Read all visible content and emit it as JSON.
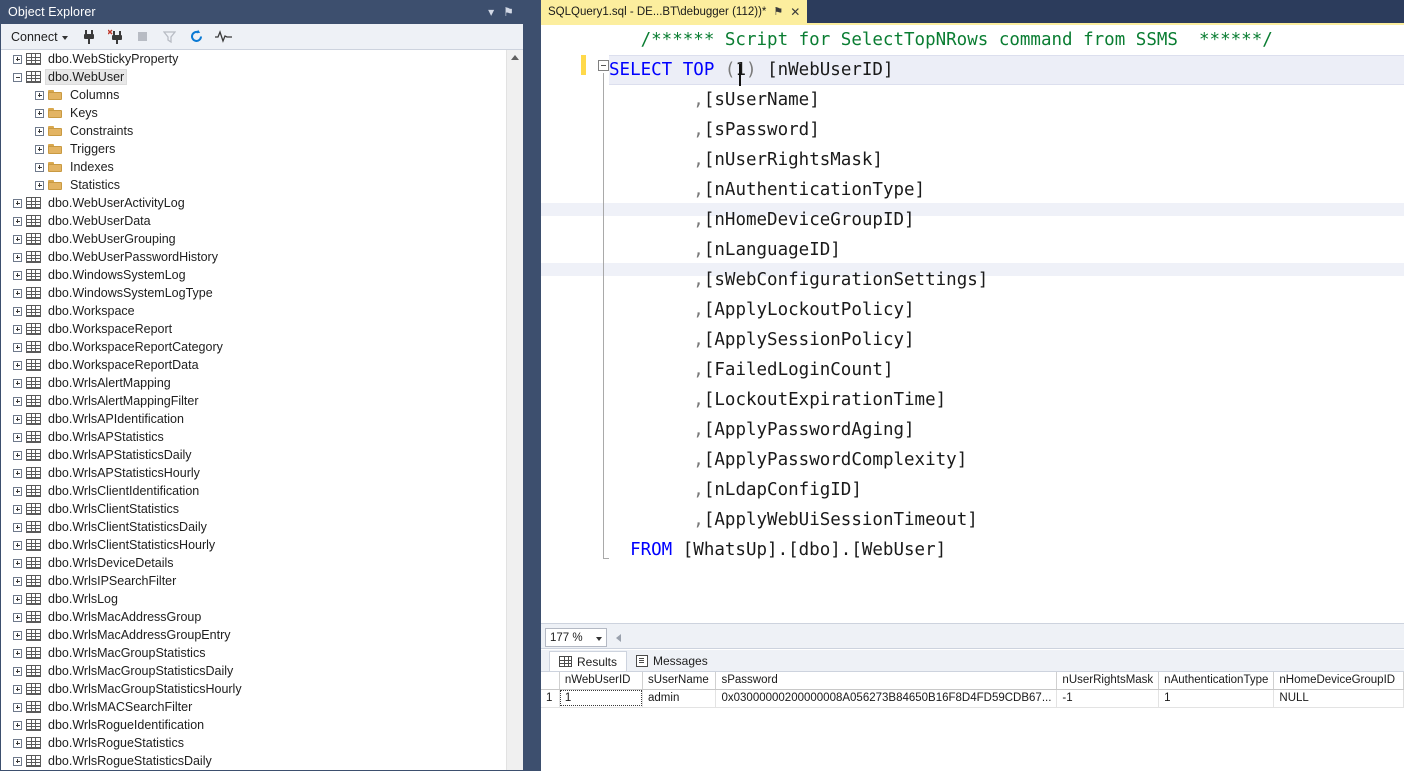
{
  "object_explorer": {
    "title": "Object Explorer",
    "title_buttons": [
      {
        "name": "dropdown-icon",
        "glyph": "▾"
      },
      {
        "name": "pin-icon",
        "glyph": "⚑"
      },
      {
        "name": "close-icon",
        "glyph": "✕"
      }
    ],
    "toolbar": {
      "connect_label": "Connect",
      "icons": [
        {
          "name": "connect-icon",
          "title": "Connect"
        },
        {
          "name": "disconnect-icon",
          "title": "Disconnect"
        },
        {
          "name": "stop-icon",
          "title": "Stop"
        },
        {
          "name": "filter-icon",
          "title": "Filter"
        },
        {
          "name": "refresh-icon",
          "title": "Refresh"
        },
        {
          "name": "activity-monitor-icon",
          "title": "Activity Monitor"
        }
      ]
    },
    "tree": [
      {
        "label": "dbo.WebStickyProperty",
        "indent": 0,
        "icon": "table",
        "state": "plus"
      },
      {
        "label": "dbo.WebUser",
        "indent": 0,
        "icon": "table",
        "state": "minus",
        "selected": true
      },
      {
        "label": "Columns",
        "indent": 1,
        "icon": "folder",
        "state": "plus"
      },
      {
        "label": "Keys",
        "indent": 1,
        "icon": "folder",
        "state": "plus"
      },
      {
        "label": "Constraints",
        "indent": 1,
        "icon": "folder",
        "state": "plus"
      },
      {
        "label": "Triggers",
        "indent": 1,
        "icon": "folder",
        "state": "plus"
      },
      {
        "label": "Indexes",
        "indent": 1,
        "icon": "folder",
        "state": "plus"
      },
      {
        "label": "Statistics",
        "indent": 1,
        "icon": "folder",
        "state": "plus"
      },
      {
        "label": "dbo.WebUserActivityLog",
        "indent": 0,
        "icon": "table",
        "state": "plus"
      },
      {
        "label": "dbo.WebUserData",
        "indent": 0,
        "icon": "table",
        "state": "plus"
      },
      {
        "label": "dbo.WebUserGrouping",
        "indent": 0,
        "icon": "table",
        "state": "plus"
      },
      {
        "label": "dbo.WebUserPasswordHistory",
        "indent": 0,
        "icon": "table",
        "state": "plus"
      },
      {
        "label": "dbo.WindowsSystemLog",
        "indent": 0,
        "icon": "table",
        "state": "plus"
      },
      {
        "label": "dbo.WindowsSystemLogType",
        "indent": 0,
        "icon": "table",
        "state": "plus"
      },
      {
        "label": "dbo.Workspace",
        "indent": 0,
        "icon": "table",
        "state": "plus"
      },
      {
        "label": "dbo.WorkspaceReport",
        "indent": 0,
        "icon": "table",
        "state": "plus"
      },
      {
        "label": "dbo.WorkspaceReportCategory",
        "indent": 0,
        "icon": "table",
        "state": "plus"
      },
      {
        "label": "dbo.WorkspaceReportData",
        "indent": 0,
        "icon": "table",
        "state": "plus"
      },
      {
        "label": "dbo.WrlsAlertMapping",
        "indent": 0,
        "icon": "table",
        "state": "plus"
      },
      {
        "label": "dbo.WrlsAlertMappingFilter",
        "indent": 0,
        "icon": "table",
        "state": "plus"
      },
      {
        "label": "dbo.WrlsAPIdentification",
        "indent": 0,
        "icon": "table",
        "state": "plus"
      },
      {
        "label": "dbo.WrlsAPStatistics",
        "indent": 0,
        "icon": "table",
        "state": "plus"
      },
      {
        "label": "dbo.WrlsAPStatisticsDaily",
        "indent": 0,
        "icon": "table",
        "state": "plus"
      },
      {
        "label": "dbo.WrlsAPStatisticsHourly",
        "indent": 0,
        "icon": "table",
        "state": "plus"
      },
      {
        "label": "dbo.WrlsClientIdentification",
        "indent": 0,
        "icon": "table",
        "state": "plus"
      },
      {
        "label": "dbo.WrlsClientStatistics",
        "indent": 0,
        "icon": "table",
        "state": "plus"
      },
      {
        "label": "dbo.WrlsClientStatisticsDaily",
        "indent": 0,
        "icon": "table",
        "state": "plus"
      },
      {
        "label": "dbo.WrlsClientStatisticsHourly",
        "indent": 0,
        "icon": "table",
        "state": "plus"
      },
      {
        "label": "dbo.WrlsDeviceDetails",
        "indent": 0,
        "icon": "table",
        "state": "plus"
      },
      {
        "label": "dbo.WrlsIPSearchFilter",
        "indent": 0,
        "icon": "table",
        "state": "plus"
      },
      {
        "label": "dbo.WrlsLog",
        "indent": 0,
        "icon": "table",
        "state": "plus"
      },
      {
        "label": "dbo.WrlsMacAddressGroup",
        "indent": 0,
        "icon": "table",
        "state": "plus"
      },
      {
        "label": "dbo.WrlsMacAddressGroupEntry",
        "indent": 0,
        "icon": "table",
        "state": "plus"
      },
      {
        "label": "dbo.WrlsMacGroupStatistics",
        "indent": 0,
        "icon": "table",
        "state": "plus"
      },
      {
        "label": "dbo.WrlsMacGroupStatisticsDaily",
        "indent": 0,
        "icon": "table",
        "state": "plus"
      },
      {
        "label": "dbo.WrlsMacGroupStatisticsHourly",
        "indent": 0,
        "icon": "table",
        "state": "plus"
      },
      {
        "label": "dbo.WrlsMACSearchFilter",
        "indent": 0,
        "icon": "table",
        "state": "plus"
      },
      {
        "label": "dbo.WrlsRogueIdentification",
        "indent": 0,
        "icon": "table",
        "state": "plus"
      },
      {
        "label": "dbo.WrlsRogueStatistics",
        "indent": 0,
        "icon": "table",
        "state": "plus"
      },
      {
        "label": "dbo.WrlsRogueStatisticsDaily",
        "indent": 0,
        "icon": "table",
        "state": "plus"
      }
    ]
  },
  "editor": {
    "tab": {
      "label": "SQLQuery1.sql - DE...BT\\debugger (112))*",
      "pin_glyph": "⚑",
      "close_glyph": "✕"
    },
    "code_lines": [
      {
        "type": "comment",
        "text": "   /****** Script for SelectTopNRows command from SSMS  ******/"
      },
      {
        "type": "select",
        "kw1": "SELECT",
        "kw2": "TOP",
        "open": " (",
        "num": "1",
        "close": ") ",
        "ident": "[nWebUserID]"
      },
      {
        "type": "col",
        "text": "        ,[sUserName]"
      },
      {
        "type": "col",
        "text": "        ,[sPassword]"
      },
      {
        "type": "col",
        "text": "        ,[nUserRightsMask]"
      },
      {
        "type": "col",
        "text": "        ,[nAuthenticationType]"
      },
      {
        "type": "col",
        "text": "        ,[nHomeDeviceGroupID]"
      },
      {
        "type": "col",
        "text": "        ,[nLanguageID]"
      },
      {
        "type": "col",
        "text": "        ,[sWebConfigurationSettings]"
      },
      {
        "type": "col",
        "text": "        ,[ApplyLockoutPolicy]"
      },
      {
        "type": "col",
        "text": "        ,[ApplySessionPolicy]"
      },
      {
        "type": "col",
        "text": "        ,[FailedLoginCount]"
      },
      {
        "type": "col",
        "text": "        ,[LockoutExpirationTime]"
      },
      {
        "type": "col",
        "text": "        ,[ApplyPasswordAging]"
      },
      {
        "type": "col",
        "text": "        ,[ApplyPasswordComplexity]"
      },
      {
        "type": "col",
        "text": "        ,[nLdapConfigID]"
      },
      {
        "type": "col",
        "text": "        ,[ApplyWebUiSessionTimeout]"
      },
      {
        "type": "from",
        "kw": "  FROM",
        "rest": " [WhatsUp].[dbo].[WebUser]"
      }
    ]
  },
  "results_pane": {
    "zoom_level": "177 %",
    "tabs": [
      {
        "label": "Results",
        "icon": "grid-icon",
        "active": true
      },
      {
        "label": "Messages",
        "icon": "messages-icon",
        "active": false
      }
    ],
    "grid": {
      "columns": [
        "nWebUserID",
        "sUserName",
        "sPassword",
        "nUserRightsMask",
        "nAuthenticationType",
        "nHomeDeviceGroupID"
      ],
      "rows": [
        {
          "number": "1",
          "cells": [
            "1",
            "admin",
            "0x03000000200000008A056273B84650B16F8D4FD59CDB67...",
            "-1",
            "1",
            "NULL"
          ]
        }
      ]
    }
  },
  "colors": {
    "chrome_dark": "#3d4f6e",
    "tabstrip_dark": "#2c3c5c",
    "tab_active": "#fcee9e",
    "keyword_blue": "#0000ff",
    "comment_green": "#0a7d32",
    "change_bar_yellow": "#ffd94a",
    "null_cell": "#fdf8d8"
  }
}
